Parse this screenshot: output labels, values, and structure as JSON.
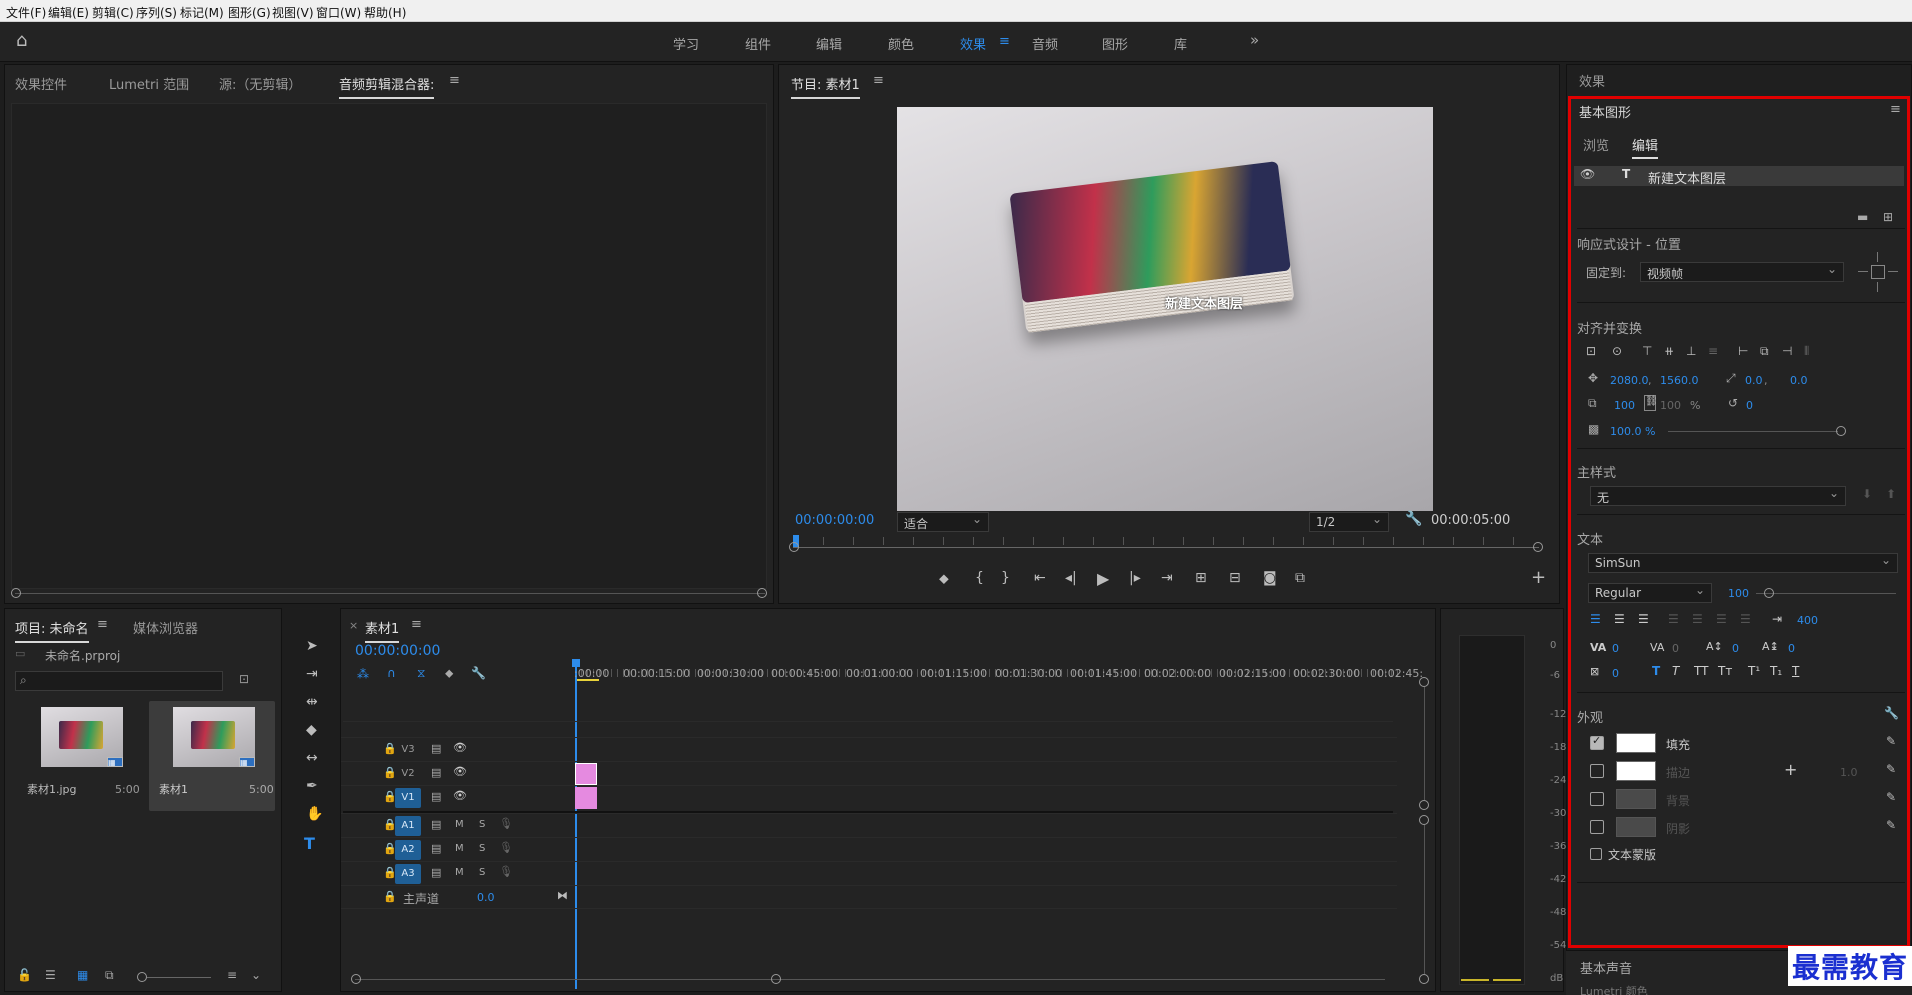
{
  "menu": [
    "文件(F)",
    "编辑(E)",
    "剪辑(C)",
    "序列(S)",
    "标记(M)",
    "图形(G)",
    "视图(V)",
    "窗口(W)",
    "帮助(H)"
  ],
  "workspaces": {
    "tabs": [
      "学习",
      "组件",
      "编辑",
      "颜色",
      "效果",
      "音频",
      "图形",
      "库"
    ],
    "active": "效果",
    "more": "»"
  },
  "source_panel": {
    "tabs": [
      "效果控件",
      "Lumetri 范围",
      "源:（无剪辑）",
      "音频剪辑混合器:"
    ],
    "active_tab": "音频剪辑混合器:"
  },
  "program_monitor": {
    "title": "节目: 素材1",
    "overlay_text": "新建文本图层",
    "timecode_current": "00:00:00:00",
    "fit": "适合",
    "quality": "1/2",
    "timecode_duration": "00:00:05:00"
  },
  "project_panel": {
    "tabs": [
      "项目: 未命名",
      "媒体浏览器"
    ],
    "file": "未命名.prproj",
    "search_placeholder": "",
    "items": [
      {
        "name": "素材1.jpg",
        "duration": "5:00"
      },
      {
        "name": "素材1",
        "duration": "5:00"
      }
    ]
  },
  "timeline": {
    "title": "素材1",
    "timecode": "00:00:00:00",
    "ticks": [
      ":00:00",
      "00:00:15:00",
      "00:00:30:00",
      "00:00:45:00",
      "00:01:00:00",
      "00:01:15:00",
      "00:01:30:00",
      "00:01:45:00",
      "00:02:00:00",
      "00:02:15:00",
      "00:02:30:00",
      "00:02:45:"
    ],
    "video_tracks": [
      "V3",
      "V2",
      "V1"
    ],
    "audio_tracks": [
      "A1",
      "A2",
      "A3"
    ],
    "mute": "M",
    "solo": "S",
    "master": "主声道",
    "master_value": "0.0"
  },
  "meter": {
    "labels": [
      "0",
      "-6",
      "-12",
      "-18",
      "-24",
      "-30",
      "-36",
      "-42",
      "-48",
      "-54",
      "dB"
    ]
  },
  "right_header": "效果",
  "essential_graphics": {
    "title": "基本图形",
    "tabs": [
      "浏览",
      "编辑"
    ],
    "active_tab": "编辑",
    "layer": "新建文本图层",
    "responsive_label": "响应式设计 - 位置",
    "pin_label": "固定到:",
    "pin_value": "视频帧",
    "align_label": "对齐并变换",
    "pos_x": "2080.0",
    "pos_y": "1560.0",
    "anchor_x": "0.0",
    "anchor_y": "0.0",
    "scale": "100",
    "scale_h": "100",
    "percent": "%",
    "rotation": "0",
    "opacity": "100.0 %",
    "master_style_label": "主样式",
    "master_style_value": "无",
    "text_label": "文本",
    "font": "SimSun",
    "font_style": "Regular",
    "font_size": "100",
    "tracking_value": "400",
    "kerning": "0",
    "tracking": "0",
    "leading": "0",
    "baseline": "0",
    "tsume": "0",
    "appearance_label": "外观",
    "fill_label": "填充",
    "stroke_label": "描边",
    "stroke_width": "1.0",
    "background_label": "背景",
    "shadow_label": "阴影",
    "mask_label": "文本蒙版"
  },
  "bottom_right": {
    "essential_sound": "基本声音",
    "lumetri": "Lumetri 颜色"
  },
  "watermark": "最需教育",
  "colors": {
    "accent": "#2d8ceb",
    "highlight_box": "#e00000",
    "clip": "#e58ae0",
    "track_selected": "#1f5f96"
  }
}
